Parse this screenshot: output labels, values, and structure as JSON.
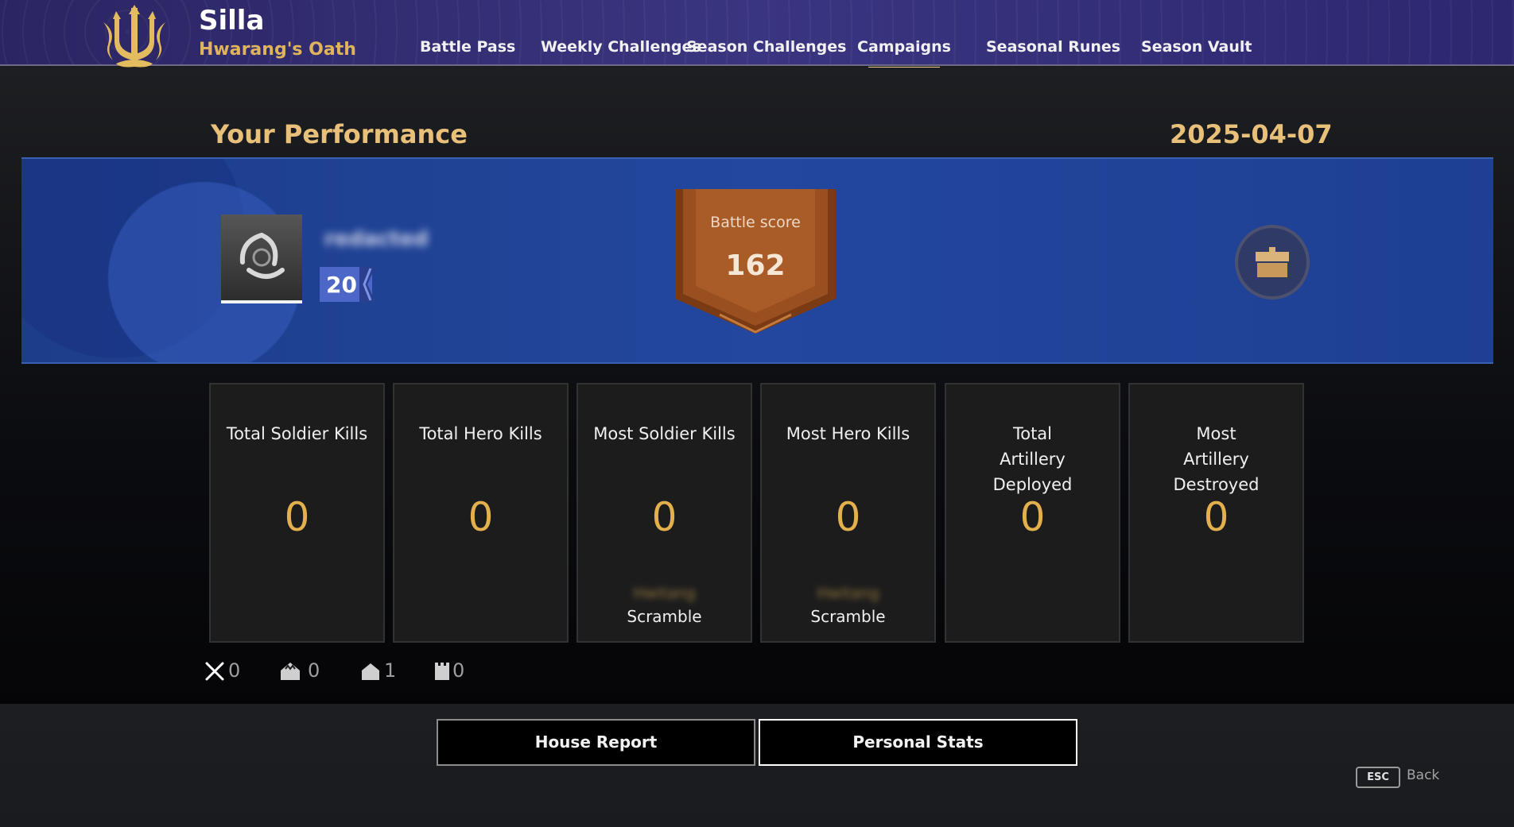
{
  "header": {
    "title": "Silla",
    "subtitle": "Hwarang's Oath",
    "emblem_icon": "trident-crest-icon",
    "tabs": [
      {
        "label": "Battle Pass",
        "active": false
      },
      {
        "label": "Weekly Challenges",
        "active": false
      },
      {
        "label": "Season Challenges",
        "active": false
      },
      {
        "label": "Campaigns",
        "active": true
      },
      {
        "label": "Seasonal Runes",
        "active": false
      },
      {
        "label": "Season Vault",
        "active": false
      }
    ]
  },
  "performance": {
    "title": "Your Performance",
    "date": "2025-04-07",
    "player": {
      "name": "redacted",
      "level": "20",
      "avatar_icon": "triskele-emblem-icon"
    },
    "battle_score": {
      "label": "Battle score",
      "value": "162"
    },
    "reward_icon": "reward-chest-icon"
  },
  "stats": [
    {
      "title": "Total Soldier Kills",
      "value": "0",
      "sub": ""
    },
    {
      "title": "Total Hero Kills",
      "value": "0",
      "sub": ""
    },
    {
      "title": "Most Soldier Kills",
      "value": "0",
      "sub_blurred": "Hwitang",
      "sub": "Scramble"
    },
    {
      "title": "Most Hero Kills",
      "value": "0",
      "sub_blurred": "Hwitang",
      "sub": "Scramble"
    },
    {
      "title": "Total Artillery Deployed",
      "value": "0",
      "sub": ""
    },
    {
      "title": "Most Artillery Destroyed",
      "value": "0",
      "sub": ""
    }
  ],
  "resources": [
    {
      "icon": "crossed-swords-icon",
      "value": "0"
    },
    {
      "icon": "crown-house-icon",
      "value": "0"
    },
    {
      "icon": "house-icon",
      "value": "1"
    },
    {
      "icon": "tower-icon",
      "value": "0"
    }
  ],
  "footer": {
    "house_report": "House Report",
    "personal_stats": "Personal Stats",
    "esc_key": "ESC",
    "back": "Back"
  },
  "colors": {
    "accent_gold": "#e3b04d",
    "title_gold": "#e8c07a",
    "header_purple": "#352f78",
    "banner_blue": "#23479e",
    "score_bronze": "#9a4f21"
  }
}
